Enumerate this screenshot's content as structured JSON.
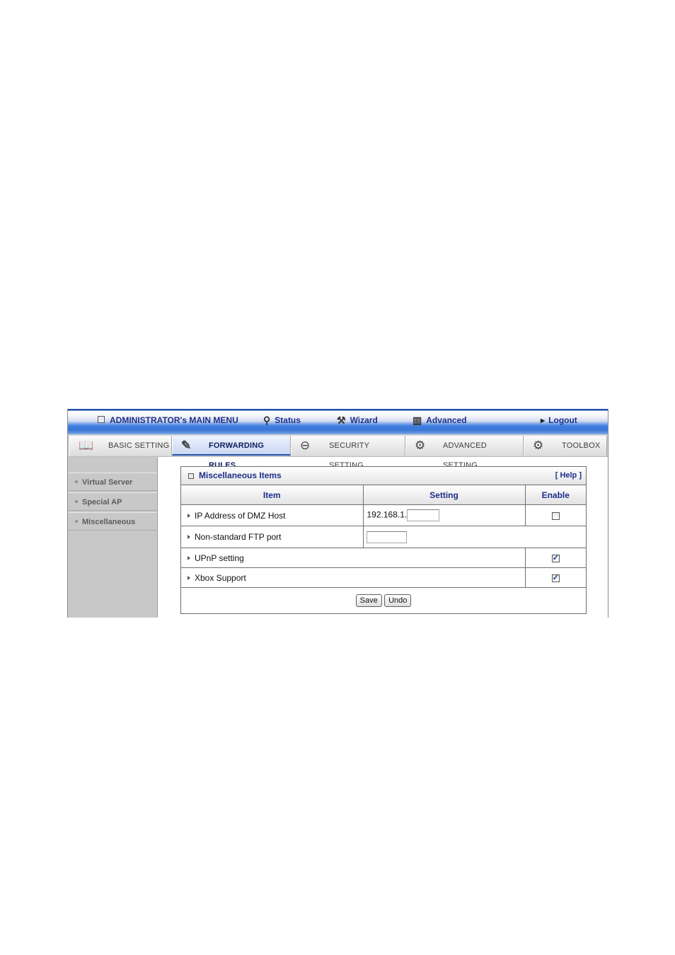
{
  "top_menu": {
    "main_menu": "ADMINISTRATOR's MAIN MENU",
    "status": "Status",
    "wizard": "Wizard",
    "advanced": "Advanced",
    "logout": "Logout"
  },
  "tabs": [
    {
      "label": "BASIC SETTING",
      "icon": "book-icon"
    },
    {
      "label": "FORWARDING RULES",
      "icon": "forwarding-icon",
      "active": true
    },
    {
      "label": "SECURITY SETTING",
      "icon": "lock-icon"
    },
    {
      "label": "ADVANCED SETTING",
      "icon": "gear-box-icon"
    },
    {
      "label": "TOOLBOX",
      "icon": "toolbox-icon"
    }
  ],
  "sidebar": {
    "items": [
      {
        "label": "Virtual Server"
      },
      {
        "label": "Special AP"
      },
      {
        "label": "Miscellaneous"
      }
    ]
  },
  "panel": {
    "title": "Miscellaneous Items",
    "help": "[ Help ]",
    "columns": {
      "item": "Item",
      "setting": "Setting",
      "enable": "Enable"
    },
    "rows": {
      "dmz": {
        "label": "IP Address of DMZ Host",
        "prefix": "192.168.1.",
        "value": "",
        "enabled": false
      },
      "ftp": {
        "label": "Non-standard FTP port",
        "value": ""
      },
      "upnp": {
        "label": "UPnP setting",
        "enabled": true
      },
      "xbox": {
        "label": "Xbox Support",
        "enabled": true
      }
    },
    "buttons": {
      "save": "Save",
      "undo": "Undo"
    }
  },
  "colors": {
    "brand_blue": "#1c2f8a",
    "bar_blue": "#3a76d6",
    "sidebar_gray": "#c8c8c8"
  }
}
